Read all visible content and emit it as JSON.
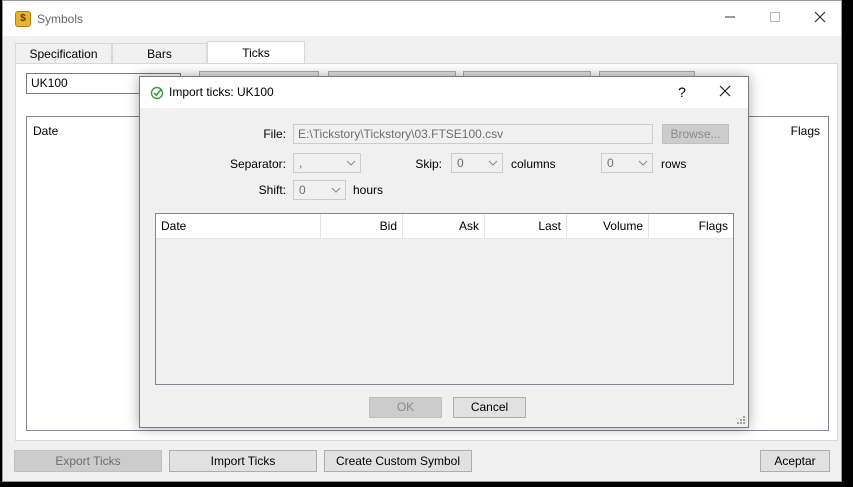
{
  "symbols_window": {
    "title": "Symbols",
    "tabs": [
      {
        "label": "Specification",
        "active": false
      },
      {
        "label": "Bars",
        "active": false
      },
      {
        "label": "Ticks",
        "active": true
      }
    ],
    "symbol_value": "UK100",
    "table_columns_visible": [
      "Date",
      "Flags"
    ],
    "buttons": {
      "export_ticks": "Export Ticks",
      "import_ticks": "Import Ticks",
      "create_custom_symbol": "Create Custom Symbol",
      "accept": "Aceptar"
    }
  },
  "import_dialog": {
    "title": "Import ticks: UK100",
    "help_glyph": "?",
    "close_glyph": "✕",
    "file_label": "File:",
    "file_value": "E:\\Tickstory\\Tickstory\\03.FTSE100.csv",
    "browse_label": "Browse...",
    "separator_label": "Separator:",
    "separator_value": ",",
    "skip_label": "Skip:",
    "skip_columns_value": "0",
    "columns_label": "columns",
    "skip_rows_value": "0",
    "rows_label": "rows",
    "shift_label": "Shift:",
    "shift_value": "0",
    "hours_label": "hours",
    "preview_columns": [
      "Date",
      "Bid",
      "Ask",
      "Last",
      "Volume",
      "Flags"
    ],
    "ok_label": "OK",
    "cancel_label": "Cancel"
  },
  "colors": {
    "accent_icon_green": "#3c9a3c",
    "disabled_text": "#6d6d6d",
    "chart_background": "#000000",
    "chart_tick": "#00c000"
  },
  "icons": {
    "window_icon": "symbols-coin-icon",
    "dialog_icon": "import-check-icon"
  }
}
